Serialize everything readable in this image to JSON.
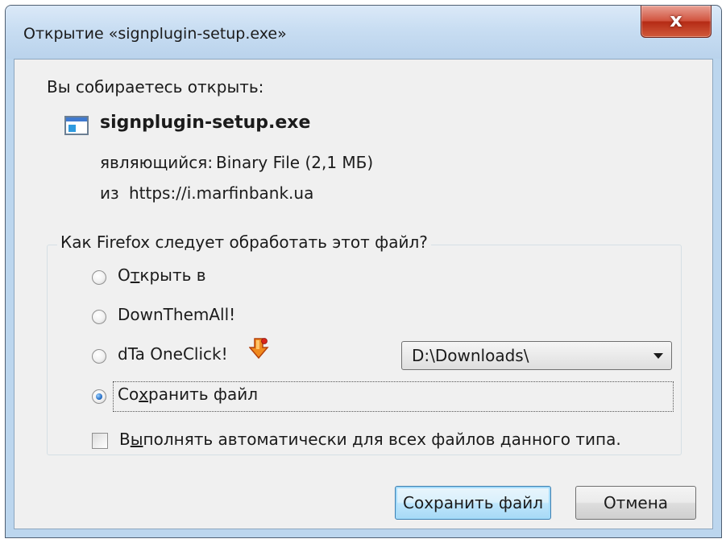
{
  "window": {
    "title": "Открытие «signplugin-setup.exe»",
    "close_label": "x"
  },
  "dialog": {
    "prompt": "Вы собираетесь открыть:",
    "file_name": "signplugin-setup.exe",
    "type_label": "являющийся:",
    "type_value": "Binary File (2,1 МБ)",
    "from_label": "из",
    "from_value": "https://i.marfinbank.ua"
  },
  "group": {
    "legend": "Как Firefox следует обработать этот файл?",
    "options": [
      {
        "label_pre": "О",
        "label_ul": "т",
        "label_post": "крыть в",
        "checked": false
      },
      {
        "label": "DownThemAll!",
        "checked": false
      },
      {
        "label": "dTa OneClick!",
        "checked": false
      },
      {
        "label_pre": "Со",
        "label_ul": "х",
        "label_post": "ранить файл",
        "checked": true
      }
    ],
    "dropdown_value": "D:\\Downloads\\",
    "auto_pre": "В",
    "auto_ul": "ы",
    "auto_post": "полнять автоматически для всех файлов данного типа.",
    "auto_checked": false
  },
  "buttons": {
    "save": "Сохранить файл",
    "cancel": "Отмена"
  },
  "icons": {
    "file": "executable-file-icon",
    "dta": "dta-oneclick-icon"
  },
  "colors": {
    "frame": "#bcd6ee",
    "close": "#c7432b",
    "client": "#f0f0f0",
    "default_button": "#bee6fd"
  }
}
